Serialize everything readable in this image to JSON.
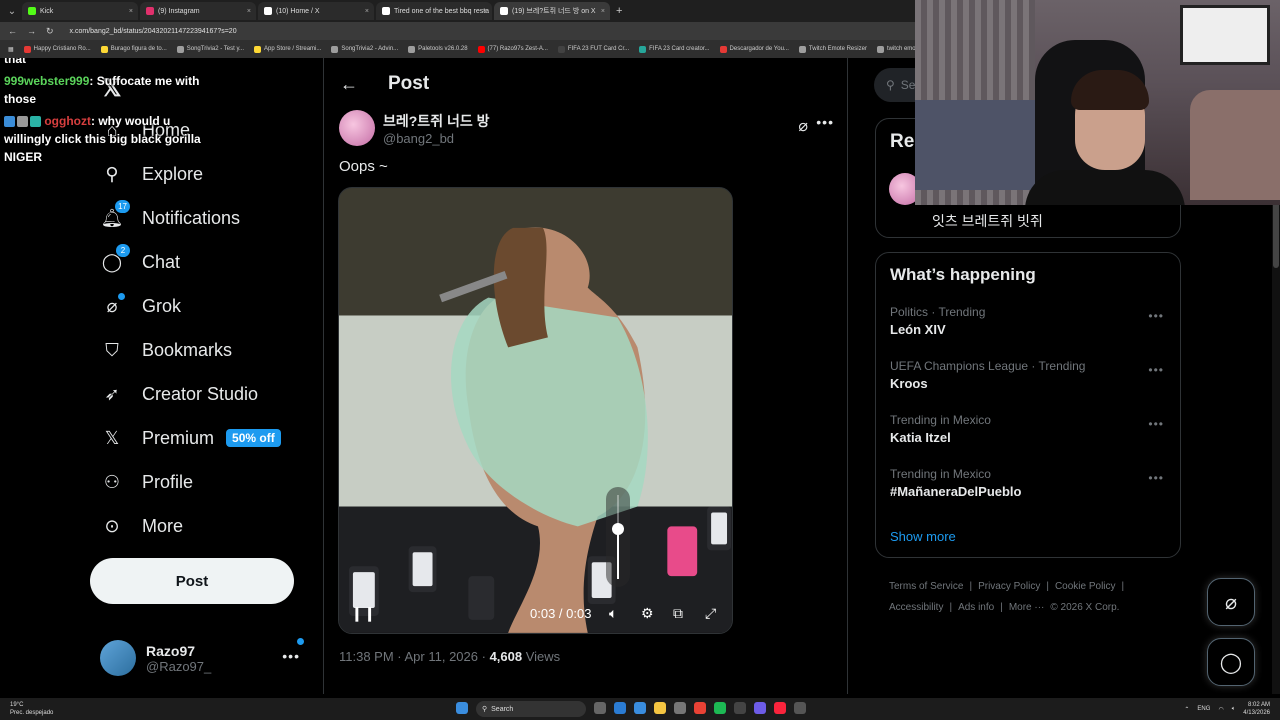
{
  "browser": {
    "tabs": [
      {
        "label": "Kick",
        "color": "#53fc18",
        "active": false
      },
      {
        "label": "(9) Instagram",
        "color": "#e1306c",
        "active": false
      },
      {
        "label": "(10) Home / X",
        "color": "#ffffff",
        "active": false
      },
      {
        "label": "Tired one of the best bbq resta",
        "color": "#ffffff",
        "active": false
      },
      {
        "label": "(19) 브레?트쥐 너드 방 on X",
        "color": "#ffffff",
        "active": true
      }
    ],
    "new_tab": "+",
    "url": "x.com/bang2_bd/status/2043202114722394167?s=20",
    "bookmarks": [
      {
        "label": "Happy Cristiano Ro...",
        "color": "#e53935"
      },
      {
        "label": "Burago figura de to...",
        "color": "#fdd835"
      },
      {
        "label": "SongTrivia2 - Test y...",
        "color": "#9e9e9e"
      },
      {
        "label": "App Store / Streami...",
        "color": "#fdd835"
      },
      {
        "label": "SongTrivia2 - Advin...",
        "color": "#9e9e9e"
      },
      {
        "label": "Paletools v26.0.28",
        "color": "#9e9e9e"
      },
      {
        "label": "(77) Razo97s Zest-A...",
        "color": "#ff0000"
      },
      {
        "label": "FIFA 23 FUT Card Cr...",
        "color": "#424242"
      },
      {
        "label": "FIFA 23 Card creator...",
        "color": "#26a69a"
      },
      {
        "label": "Descargador de You...",
        "color": "#e53935"
      },
      {
        "label": "Twitch Emote Resizer",
        "color": "#9e9e9e"
      },
      {
        "label": "twitch emote re...",
        "color": "#9e9e9e"
      }
    ]
  },
  "chat": [
    {
      "user": "",
      "text": "that"
    },
    {
      "user": "999webster999",
      "text": ": Suffocate me with those"
    },
    {
      "user": "ogghozt",
      "text": ": why would u willingly click this big black gorilla NIGER"
    }
  ],
  "leftnav": {
    "items": [
      {
        "label": "Home",
        "icon": "home-icon",
        "glyph": "⌂",
        "badge": "",
        "dot": false
      },
      {
        "label": "Explore",
        "icon": "search-icon",
        "glyph": "⚲",
        "badge": "",
        "dot": false
      },
      {
        "label": "Notifications",
        "icon": "bell-icon",
        "glyph": "🔔︎",
        "badge": "17",
        "dot": false
      },
      {
        "label": "Chat",
        "icon": "chat-icon",
        "glyph": "◯",
        "badge": "2",
        "dot": false
      },
      {
        "label": "Grok",
        "icon": "grok-icon",
        "glyph": "⌀",
        "badge": "",
        "dot": true
      },
      {
        "label": "Bookmarks",
        "icon": "bookmark-icon",
        "glyph": "⛉",
        "badge": "",
        "dot": false
      },
      {
        "label": "Creator Studio",
        "icon": "rocket-icon",
        "glyph": "➶",
        "badge": "",
        "dot": false
      },
      {
        "label": "Premium",
        "icon": "x-premium-icon",
        "glyph": "𝕏",
        "badge": "",
        "dot": false
      },
      {
        "label": "Profile",
        "icon": "person-icon",
        "glyph": "⚇",
        "badge": "",
        "dot": false
      },
      {
        "label": "More",
        "icon": "more-circle-icon",
        "glyph": "⊙",
        "badge": "",
        "dot": false
      }
    ],
    "premium_tag": "50% off",
    "post_label": "Post",
    "account": {
      "name": "Razo97",
      "handle": "@Razo97_"
    }
  },
  "main": {
    "title": "Post",
    "author": {
      "name": "브레?트쥐 너드 방",
      "handle": "@bang2_bd"
    },
    "text": "Oops ~",
    "video": {
      "time": "0:03 / 0:03",
      "volume_level": 0.6,
      "playing": true
    },
    "meta": {
      "time": "11:38 PM · Apr 11, 2026 · ",
      "views_count": "4,608",
      "views_label": " Views"
    }
  },
  "right": {
    "search_placeholder": "Se",
    "relevant_title": "Rel",
    "relevant_name": "잇츠 브레트쥐 빗쥐",
    "happening_title": "What’s happening",
    "trends": [
      {
        "category": "Politics · Trending",
        "term": "León XIV"
      },
      {
        "category": "UEFA Champions League · Trending",
        "term": "Kroos"
      },
      {
        "category": "Trending in Mexico",
        "term": "Katia Itzel"
      },
      {
        "category": "Trending in Mexico",
        "term": "#MañaneraDelPueblo"
      }
    ],
    "show_more": "Show more",
    "footer": [
      "Terms of Service",
      "|",
      "Privacy Policy",
      "|",
      "Cookie Policy",
      "|",
      "Accessibility",
      "|",
      "Ads info",
      "|",
      "More ···",
      "© 2026 X Corp."
    ]
  },
  "taskbar": {
    "weather_temp": "19°C",
    "weather_desc": "Prec. despejado",
    "search": "Search",
    "lang": "ENG",
    "time": "8:02 AM",
    "date": "4/13/2026"
  },
  "colors": {
    "accent": "#1d9bf0",
    "bg": "#000000",
    "text": "#e7e9ea",
    "muted": "#71767b"
  }
}
